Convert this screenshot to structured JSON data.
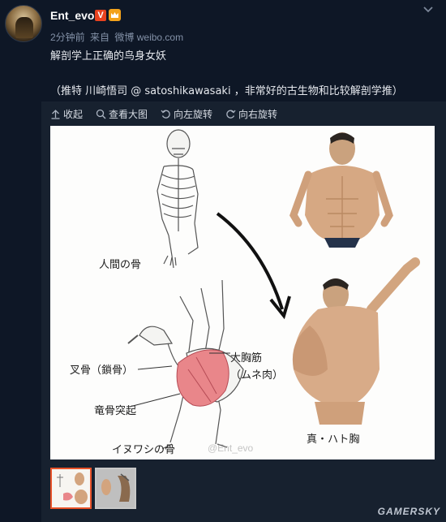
{
  "post": {
    "username": "Ent_evo",
    "verified_badge": "V",
    "meta": {
      "time": "2分钟前",
      "from_label": "来自",
      "source": "微博 weibo.com"
    },
    "text_line1": "解剖学上正确的鸟身女妖",
    "text_line2": "（推特 川崎悟司 @ satoshikawasaki ，非常好的古生物和比较解剖学推）"
  },
  "toolbar": {
    "collapse": "收起",
    "view_large": "查看大图",
    "rotate_left": "向左旋转",
    "rotate_right": "向右旋转"
  },
  "image": {
    "labels": {
      "human_bones": "人間の骨",
      "furcula": "叉骨（鎖骨）",
      "pectoral": "大胸筋",
      "pectoral_note": "（ムネ肉）",
      "keel": "竜骨突起",
      "eagle_bones": "イヌワシの骨",
      "true_pigeon_chest": "真・ハト胸"
    },
    "watermark": "@Ent_evo"
  },
  "thumbnails": {
    "count": 2,
    "selected_index": 0
  },
  "footer": {
    "site_logo": "GAMERSKY"
  },
  "colors": {
    "background": "#0e1726",
    "panel": "#17212f",
    "accent_orange": "#e8532a",
    "badge_red": "#e8421f",
    "muscle_pink": "#e9868a"
  }
}
